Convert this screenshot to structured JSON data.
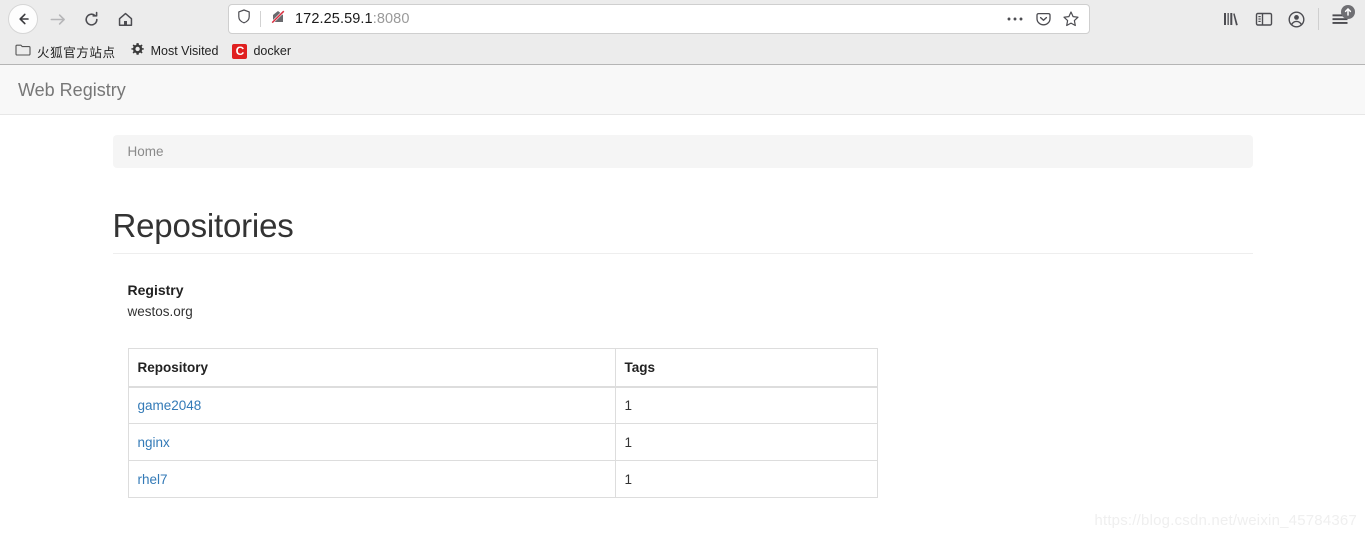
{
  "browser": {
    "nav": {
      "back": "back-button",
      "forward": "forward-button",
      "reload": "reload-button",
      "home": "home-button"
    },
    "urlbar": {
      "host": "172.25.59.1",
      "port": ":8080",
      "shield_icon": "shield-icon",
      "identity_icon": "identity-blocked-icon",
      "page_actions_icon": "ellipsis-icon",
      "pocket_icon": "pocket-icon",
      "bookmark_icon": "star-icon"
    },
    "toolbar_right": {
      "library_icon": "library-icon",
      "sidebar_icon": "sidebar-icon",
      "account_icon": "account-icon",
      "menu_icon": "hamburger-menu-icon",
      "update_badge_icon": "update-arrow-icon"
    },
    "bookmarks": [
      {
        "label": "火狐官方站点",
        "icon": "folder-icon"
      },
      {
        "label": "Most Visited",
        "icon": "gear-icon"
      },
      {
        "label": "docker",
        "icon": "docker-favicon",
        "favicon_text": "C",
        "favicon_color": "#e02020"
      }
    ]
  },
  "page": {
    "navbar_brand": "Web Registry",
    "breadcrumb": "Home",
    "title": "Repositories",
    "registry": {
      "label": "Registry",
      "host": "westos.org"
    },
    "table": {
      "columns": [
        "Repository",
        "Tags"
      ],
      "rows": [
        {
          "repository": "game2048",
          "tags": "1"
        },
        {
          "repository": "nginx",
          "tags": "1"
        },
        {
          "repository": "rhel7",
          "tags": "1"
        }
      ]
    },
    "watermark": "https://blog.csdn.net/weixin_45784367",
    "colors": {
      "link": "#337ab7",
      "navbar_bg": "#f8f8f8",
      "breadcrumb_bg": "#f5f5f5"
    }
  }
}
